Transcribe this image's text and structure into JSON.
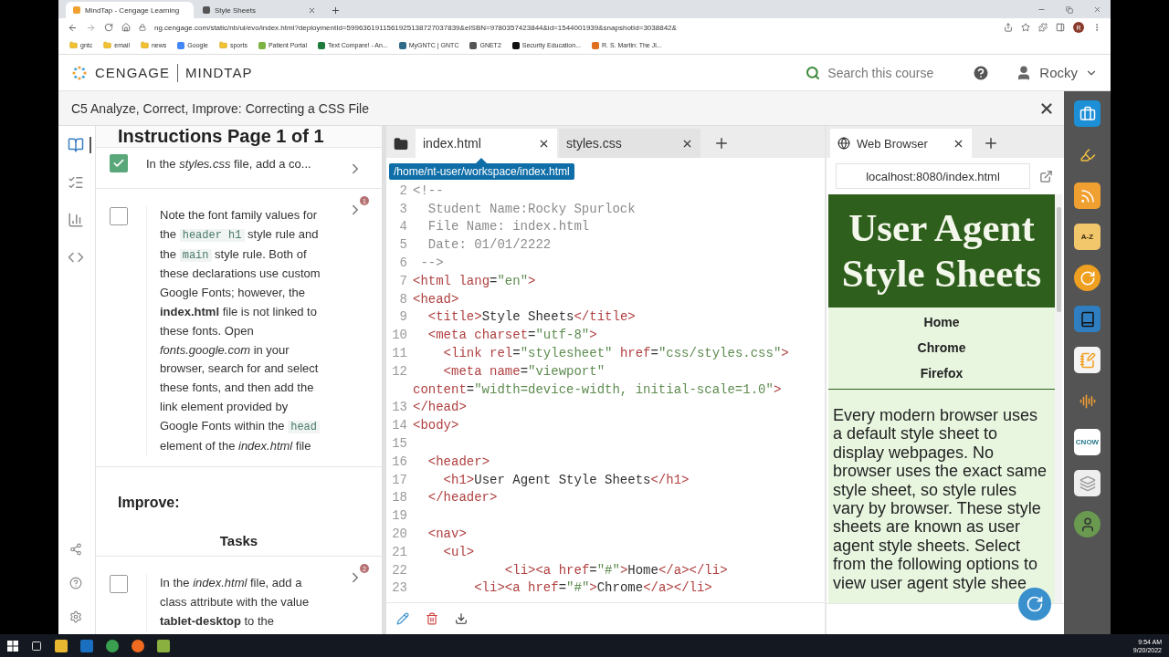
{
  "browser": {
    "tabs": [
      {
        "title": "MindTap - Cengage Learning",
        "selected": true
      },
      {
        "title": "Style Sheets",
        "selected": false
      }
    ],
    "url": "ng.cengage.com/static/nb/ui/evo/index.html?deploymentId=5996361911561925138727037839&eISBN=9780357423844&id=1544001939&snapshotId=3038842&",
    "profile_initial": "R",
    "bookmarks": [
      {
        "label": "gntc",
        "kind": "folder"
      },
      {
        "label": "email",
        "kind": "folder"
      },
      {
        "label": "news",
        "kind": "folder"
      },
      {
        "label": "Google",
        "kind": "site",
        "color": "#4285f4"
      },
      {
        "label": "sports",
        "kind": "folder"
      },
      {
        "label": "Patient Portal",
        "kind": "site",
        "color": "#7cb342"
      },
      {
        "label": "Text Compare! - An...",
        "kind": "site",
        "color": "#1e7a3c"
      },
      {
        "label": "MyGNTC | GNTC",
        "kind": "site",
        "color": "#2e6b8a"
      },
      {
        "label": "GNET2",
        "kind": "site",
        "color": "#555555"
      },
      {
        "label": "Security Education...",
        "kind": "site",
        "color": "#111111"
      },
      {
        "label": "R. S. Martin: The Ji...",
        "kind": "site",
        "color": "#e07020"
      }
    ]
  },
  "app_header": {
    "brand": "CENGAGE",
    "product": "MINDTAP",
    "search_placeholder": "Search this course",
    "user": "Rocky"
  },
  "activity": {
    "title": "C5 Analyze, Correct, Improve: Correcting a CSS File"
  },
  "rail": {
    "items": [
      {
        "selected": true
      },
      {
        "selected": false
      },
      {
        "selected": false
      },
      {
        "selected": false
      },
      {
        "selected": false
      },
      {
        "selected": false
      },
      {
        "selected": false
      }
    ]
  },
  "instructions": {
    "title": "Instructions Page 1 of 1",
    "tasks": [
      {
        "checked": true,
        "segments": [
          {
            "kind": "text",
            "text": "In the *styles.css* file, add a co..."
          }
        ]
      },
      {
        "checked": false,
        "badge": "1",
        "segments": [
          {
            "kind": "text",
            "text": "Note the font family values for the "
          },
          {
            "kind": "code",
            "text": "header h1"
          },
          {
            "kind": "text",
            "text": " style rule and the "
          },
          {
            "kind": "code",
            "text": "main"
          },
          {
            "kind": "text",
            "text": " style rule. Both of these declarations use custom Google Fonts; however, the **index.html** file is not linked to these fonts. Open *fonts.google.com* in your browser, search for and select these fonts, and then add the link element provided by Google Fonts within the "
          },
          {
            "kind": "code",
            "text": "head"
          },
          {
            "kind": "text",
            "text": " element of the *index.html* file"
          }
        ]
      }
    ],
    "improve_heading": "Improve:",
    "tasks_heading": "Tasks",
    "improve_tasks": [
      {
        "checked": false,
        "badge": "2",
        "segments": [
          {
            "kind": "text",
            "text": "In the *index.html* file, add a class attribute with the value **tablet-desktop** to the"
          }
        ]
      }
    ]
  },
  "editor": {
    "tabs": [
      {
        "label": "index.html",
        "selected": true
      },
      {
        "label": "styles.css",
        "selected": false
      }
    ],
    "tooltip": "/home/nt-user/workspace/index.html",
    "lines": [
      {
        "number": "2",
        "text": "<!--",
        "kind": "comment"
      },
      {
        "number": "3",
        "text": "  Student Name:Rocky Spurlock",
        "kind": "comment"
      },
      {
        "number": "4",
        "text": "  File Name: index.html",
        "kind": "comment"
      },
      {
        "number": "5",
        "text": "  Date: 01/01/2222",
        "kind": "comment"
      },
      {
        "number": "6",
        "text": " -->",
        "kind": "comment"
      },
      {
        "number": "7",
        "text": "<html lang=\"en\">",
        "kind": "code"
      },
      {
        "number": "8",
        "text": "<head>",
        "kind": "code"
      },
      {
        "number": "9",
        "text": "  <title>Style Sheets</title>",
        "kind": "code"
      },
      {
        "number": "10",
        "text": "  <meta charset=\"utf-8\">",
        "kind": "code"
      },
      {
        "number": "11",
        "text": "    <link rel=\"stylesheet\" href=\"css/styles.css\">",
        "kind": "code"
      },
      {
        "number": "12",
        "text": "    <meta name=\"viewport\"",
        "kind": "code"
      },
      {
        "text": "content=\"width=device-width, initial-scale=1.0\">",
        "kind": "code"
      },
      {
        "number": "13",
        "text": "</head>",
        "kind": "code"
      },
      {
        "number": "14",
        "text": "<body>",
        "kind": "code"
      },
      {
        "number": "15"
      },
      {
        "number": "16",
        "text": "  <header>",
        "kind": "code"
      },
      {
        "number": "17",
        "text": "    <h1>User Agent Style Sheets</h1>",
        "kind": "code"
      },
      {
        "number": "18",
        "text": "  </header>",
        "kind": "code"
      },
      {
        "number": "19"
      },
      {
        "number": "20",
        "text": "  <nav>",
        "kind": "code"
      },
      {
        "number": "21",
        "text": "    <ul>",
        "kind": "code"
      },
      {
        "number": "22",
        "text": "            <li><a href=\"#\">Home</a></li>",
        "kind": "code"
      },
      {
        "number": "23",
        "text": "        <li><a href=\"#\">Chrome</a></li>",
        "kind": "code"
      }
    ]
  },
  "preview": {
    "tab": "Web Browser",
    "url": "localhost:8080/index.html",
    "heading": "User Agent Style Sheets",
    "nav": [
      "Home",
      "Chrome",
      "Firefox"
    ],
    "paragraph": "Every modern browser uses a default style sheet to display webpages. No browser uses the exact same style sheet, so style rules vary by browser. These style sheets are known as user agent style sheets. Select from the following options to view user agent style shee"
  },
  "side_apps": [
    {
      "kind": "briefcase"
    },
    {
      "kind": "highlighter"
    },
    {
      "kind": "rss"
    },
    {
      "kind": "az",
      "label": "A-Z"
    },
    {
      "kind": "circle"
    },
    {
      "kind": "book"
    },
    {
      "kind": "note"
    },
    {
      "kind": "speech"
    },
    {
      "kind": "cnow",
      "label": "CNOW"
    },
    {
      "kind": "cards"
    },
    {
      "kind": "avatar"
    }
  ],
  "taskbar": {
    "time": "9:54 AM",
    "date": "9/20/2022"
  }
}
